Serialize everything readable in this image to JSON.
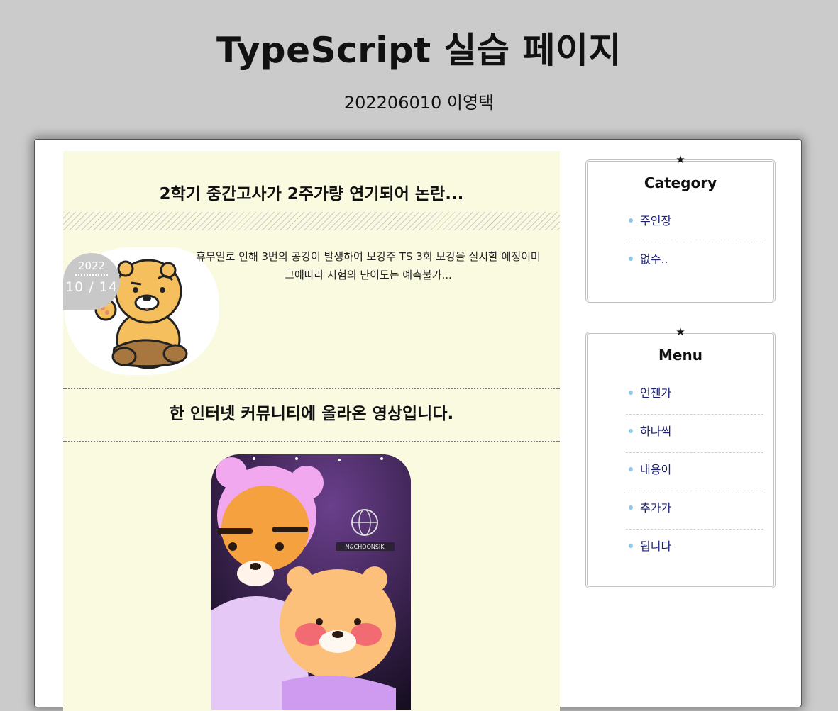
{
  "header": {
    "title": "TypeScript 실습 페이지",
    "subtitle": "202206010 이영택"
  },
  "posts": [
    {
      "title": "2학기 중간고사가 2주가량 연기되어 논란...",
      "date_year": "2022",
      "date_day": "10 / 14",
      "body": "휴무일로 인해 3번의 공강이 발생하여 보강주 TS 3회 보강을 실시할 예정이며 그애따라 시험의 난이도는 예측불가...",
      "image_icon": "lion-character-waving-image"
    },
    {
      "title": "한 인터넷 커뮤니티에 올라온 영상입니다.",
      "image_icon": "lion-characters-photo",
      "image_sign_text": "N&CHOONSIK"
    }
  ],
  "sidebar": {
    "category": {
      "star": "★",
      "title": "Category",
      "items": [
        {
          "label": "주인장"
        },
        {
          "label": "없수.."
        }
      ]
    },
    "menu": {
      "star": "★",
      "title": "Menu",
      "items": [
        {
          "label": "언젠가"
        },
        {
          "label": "하나씩"
        },
        {
          "label": "내용이"
        },
        {
          "label": "추가가"
        },
        {
          "label": "됩니다"
        }
      ]
    }
  },
  "colors": {
    "page_background": "#cbcbcb",
    "main_background": "#fafae1",
    "link": "#1a1f78",
    "bullet": "#8ec9e8",
    "date_badge": "#c8c8c8"
  }
}
